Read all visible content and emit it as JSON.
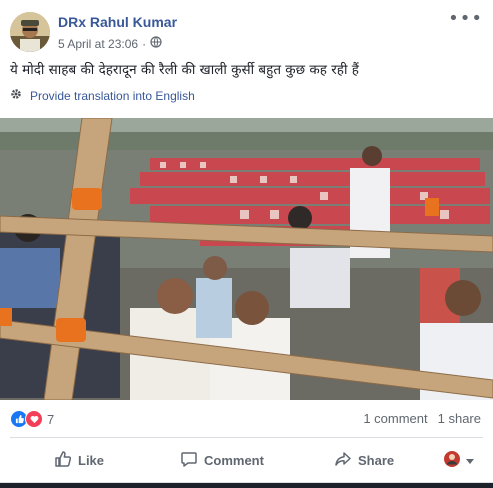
{
  "post": {
    "author": "DRx Rahul Kumar",
    "date": "5 April at 23:06",
    "separator": "·",
    "privacy_icon": "globe-icon",
    "text": "ये मोदी साहब की देहरादून की रैली की खाली कुर्सी बहुत कुछ कह रही हैं",
    "translate_label": "Provide translation into English",
    "more_label": "•••"
  },
  "reactions": {
    "count": "7",
    "comments": "1 comment",
    "shares": "1 share"
  },
  "actions": {
    "like": "Like",
    "comment": "Comment",
    "share": "Share"
  },
  "colors": {
    "link": "#385898",
    "secondary": "#606770",
    "like_blue": "#1877f2",
    "love_red": "#f33e58"
  }
}
